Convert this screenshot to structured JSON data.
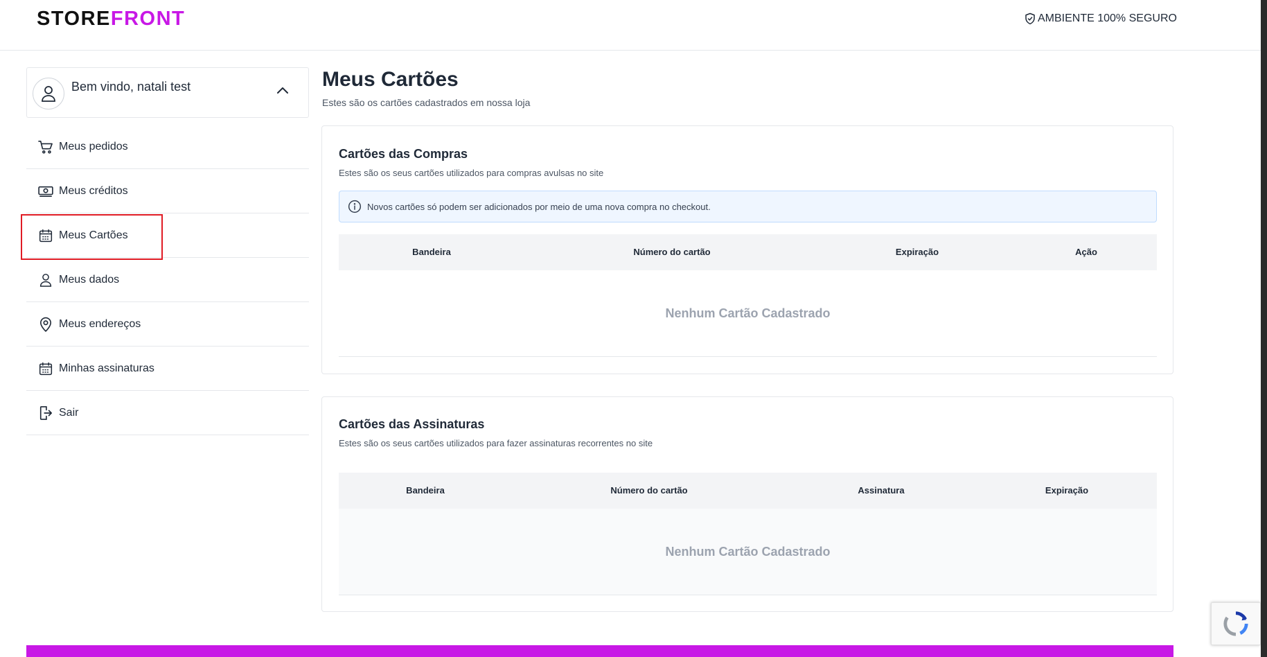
{
  "header": {
    "logo_part1": "STORE",
    "logo_part2": "FRONT",
    "secure_label": "AMBIENTE 100% SEGURO"
  },
  "sidebar": {
    "welcome": "Bem vindo, natali test",
    "items": [
      {
        "label": "Meus pedidos",
        "icon": "cart-icon"
      },
      {
        "label": "Meus créditos",
        "icon": "money-icon"
      },
      {
        "label": "Meus Cartões",
        "icon": "calendar-icon"
      },
      {
        "label": "Meus dados",
        "icon": "user-icon"
      },
      {
        "label": "Meus endereços",
        "icon": "location-pin-icon"
      },
      {
        "label": "Minhas assinaturas",
        "icon": "calendar-icon"
      },
      {
        "label": "Sair",
        "icon": "logout-icon"
      }
    ]
  },
  "main": {
    "title": "Meus Cartões",
    "subtitle": "Estes são os cartões cadastrados em nossa loja",
    "purchases": {
      "title": "Cartões das Compras",
      "subtitle": "Estes são os seus cartões utilizados para compras avulsas no site",
      "info": "Novos cartões só podem ser adicionados por meio de uma nova compra no checkout.",
      "columns": [
        "Bandeira",
        "Número do cartão",
        "Expiração",
        "Ação"
      ],
      "empty": "Nenhum Cartão Cadastrado"
    },
    "subscriptions": {
      "title": "Cartões das Assinaturas",
      "subtitle": "Estes são os seus cartões utilizados para fazer assinaturas recorrentes no site",
      "columns": [
        "Bandeira",
        "Número do cartão",
        "Assinatura",
        "Expiração"
      ],
      "empty": "Nenhum Cartão Cadastrado"
    }
  },
  "colors": {
    "brand": "#c818e6",
    "highlight": "#e01b24",
    "info_bg": "#eff6ff"
  }
}
